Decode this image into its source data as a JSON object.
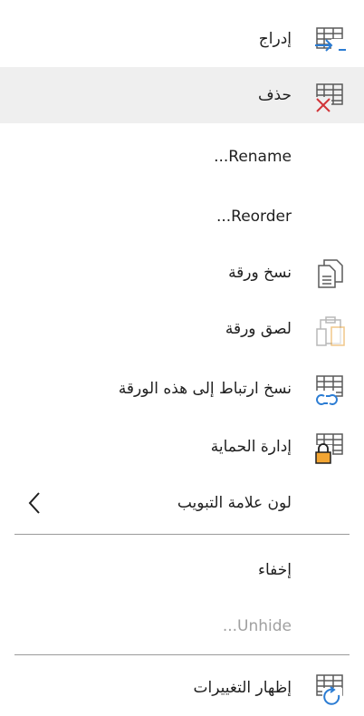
{
  "menu": {
    "items": [
      {
        "label": "إدراج",
        "icon": "insert-sheet-icon"
      },
      {
        "label": "حذف",
        "icon": "delete-sheet-icon"
      },
      {
        "label": "...Rename"
      },
      {
        "label": "...Reorder"
      },
      {
        "label": "نسخ ورقة",
        "icon": "copy-sheet-icon"
      },
      {
        "label": "لصق ورقة",
        "icon": "paste-sheet-icon"
      },
      {
        "label": "نسخ ارتباط إلى هذه الورقة",
        "icon": "link-sheet-icon"
      },
      {
        "label": "إدارة الحماية",
        "icon": "protect-sheet-icon"
      },
      {
        "label": "لون علامة التبويب",
        "icon": "chevron-left-icon"
      },
      {
        "label": "إخفاء"
      },
      {
        "label": "...Unhide"
      },
      {
        "label": "إظهار التغييرات",
        "icon": "show-changes-icon"
      }
    ]
  },
  "colors": {
    "hover_bg": "#efefef",
    "grid": "#5a5a5a",
    "accent_blue": "#2b7cd3",
    "delete_red": "#d13438",
    "lock_orange": "#f2a533",
    "paste_orange": "#e8a33d",
    "disabled_text": "#a0a0a0"
  }
}
